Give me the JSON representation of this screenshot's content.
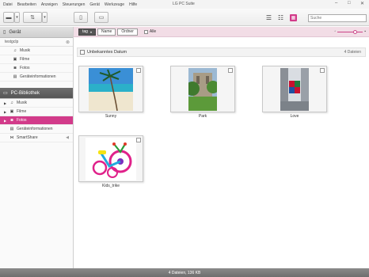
{
  "app": {
    "title": "LG PC Suite"
  },
  "menu": [
    "Datei",
    "Bearbeiten",
    "Anzeigen",
    "Steuerungen",
    "Gerät",
    "Werkzeuge",
    "Hilfe"
  ],
  "search": {
    "placeholder": "Suche"
  },
  "sidebar": {
    "device_header": "Gerät",
    "device_name": "testgclp",
    "device_items": [
      {
        "label": "Musik",
        "icon": "music-icon"
      },
      {
        "label": "Filme",
        "icon": "film-icon"
      },
      {
        "label": "Fotos",
        "icon": "photo-icon"
      },
      {
        "label": "Geräteinformationen",
        "icon": "info-icon"
      }
    ],
    "library_header": "PC-Bibliothek",
    "library_items": [
      {
        "label": "Musik",
        "icon": "music-icon"
      },
      {
        "label": "Filme",
        "icon": "film-icon"
      },
      {
        "label": "Fotos",
        "icon": "photo-icon",
        "active": true
      },
      {
        "label": "Geräteinformationen",
        "icon": "folder-icon"
      },
      {
        "label": "SmartShare",
        "icon": "share-icon"
      }
    ]
  },
  "filter": {
    "tag_label": "tag",
    "name_label": "Name",
    "folder_label": "Ordner",
    "all_label": "Alle"
  },
  "group": {
    "title": "Unbekanntes Datum",
    "count": "4 Dateien"
  },
  "photos": [
    {
      "label": "Sunny"
    },
    {
      "label": "Park"
    },
    {
      "label": "Love"
    },
    {
      "label": "Kids_trike"
    }
  ],
  "status": {
    "text": "4 Dateien, 136 KB"
  },
  "colors": {
    "accent": "#d23b8a"
  }
}
